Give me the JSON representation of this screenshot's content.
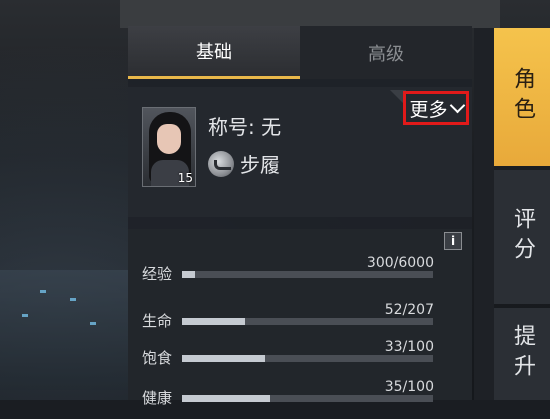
{
  "tabs": [
    {
      "label": "基础",
      "active": true
    },
    {
      "label": "高级",
      "active": false
    }
  ],
  "profile": {
    "title": "称号: 无",
    "level": "15",
    "shoe_label": "步履",
    "more_label": "更多"
  },
  "stats": [
    {
      "label": "经验",
      "value": "300/6000",
      "fill": 0.05
    },
    {
      "label": "生命",
      "value": "52/207",
      "fill": 0.251
    },
    {
      "label": "饱食",
      "value": "33/100",
      "fill": 0.33
    },
    {
      "label": "健康",
      "value": "35/100",
      "fill": 0.35
    }
  ],
  "info_label": "i",
  "side_tabs": [
    {
      "label": "角色",
      "active": true
    },
    {
      "label": "评分",
      "active": false
    },
    {
      "label": "提升",
      "active": false
    }
  ],
  "colors": {
    "accent": "#e9b84a",
    "side_active": "#f5c34c",
    "highlight_box": "#e11a1a"
  }
}
